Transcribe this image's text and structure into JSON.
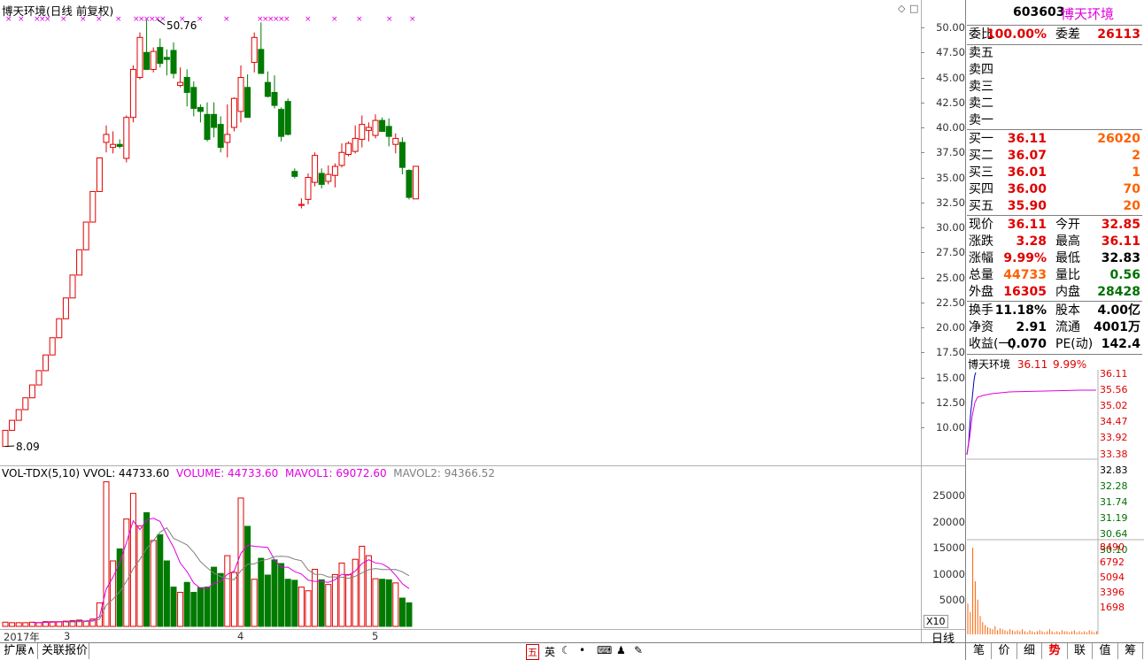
{
  "chart_header": {
    "title": "博天环境(日线 前复权)"
  },
  "annotations": {
    "high": "50.76",
    "low": "8.09"
  },
  "y_axis": {
    "ticks": [
      "50.00",
      "47.50",
      "45.00",
      "42.50",
      "40.00",
      "37.50",
      "35.00",
      "32.50",
      "30.00",
      "27.50",
      "25.00",
      "22.50",
      "20.00",
      "17.50",
      "15.00",
      "12.50",
      "10.00"
    ]
  },
  "volume_header": {
    "indicator": "VOL-TDX(5,10)",
    "vvol": "VVOL: 44733.60",
    "volume": "VOLUME: 44733.60",
    "mavol1": "MAVOL1: 69072.60",
    "mavol2": "MAVOL2: 94366.52"
  },
  "volume_axis": {
    "ticks": [
      "25000",
      "20000",
      "15000",
      "10000",
      "5000"
    ],
    "unit": "X10"
  },
  "x_axis": {
    "labels": [
      "2017年",
      "3",
      "4",
      "5"
    ]
  },
  "period_button": "日线",
  "bottom_tabs": {
    "expand": "扩展∧",
    "linked_quote": "关联报价"
  },
  "toolbar_icons": [
    "五",
    "英"
  ],
  "quote": {
    "code": "603603",
    "name": "博天环境",
    "weibi_label": "委比",
    "weibi_value": "100.00%",
    "weicha_label": "委差",
    "weicha_value": "26113",
    "sell": [
      {
        "label": "卖五"
      },
      {
        "label": "卖四"
      },
      {
        "label": "卖三"
      },
      {
        "label": "卖二"
      },
      {
        "label": "卖一"
      }
    ],
    "buy": [
      {
        "label": "买一",
        "price": "36.11",
        "vol": "26020"
      },
      {
        "label": "买二",
        "price": "36.07",
        "vol": "2"
      },
      {
        "label": "买三",
        "price": "36.01",
        "vol": "1"
      },
      {
        "label": "买四",
        "price": "36.00",
        "vol": "70"
      },
      {
        "label": "买五",
        "price": "35.90",
        "vol": "20"
      }
    ],
    "stats1": [
      {
        "l1": "现价",
        "v1": "36.11",
        "l2": "今开",
        "v2": "32.85"
      },
      {
        "l1": "涨跌",
        "v1": "3.28",
        "l2": "最高",
        "v2": "36.11"
      },
      {
        "l1": "涨幅",
        "v1": "9.99%",
        "l2": "最低",
        "v2": "32.83"
      },
      {
        "l1": "总量",
        "v1": "44733",
        "l2": "量比",
        "v2": "0.56"
      },
      {
        "l1": "外盘",
        "v1": "16305",
        "l2": "内盘",
        "v2": "28428"
      }
    ],
    "stats2": [
      {
        "l1": "换手",
        "v1": "11.18%",
        "l2": "股本",
        "v2": "4.00亿"
      },
      {
        "l1": "净资",
        "v1": "2.91",
        "l2": "流通",
        "v2": "4001万"
      },
      {
        "l1": "收益(一)",
        "v1": "0.070",
        "l2": "PE(动)",
        "v2": "142.4"
      }
    ]
  },
  "mini": {
    "name": "博天环境",
    "price": "36.11",
    "pct": "9.99%",
    "price_ticks": [
      "36.11",
      "35.56",
      "35.02",
      "34.47",
      "33.92",
      "33.38",
      "32.83",
      "32.28",
      "31.74",
      "31.19",
      "30.64",
      "30.10"
    ],
    "vol_ticks": [
      "8490",
      "6792",
      "5094",
      "3396",
      "1698"
    ]
  },
  "right_tabs": [
    "笔",
    "价",
    "细",
    "势",
    "联",
    "值",
    "筹"
  ],
  "colors": {
    "up": "#e00000",
    "down": "#007a00",
    "ma1": "#e000e0",
    "ma2": "#808080",
    "grid": "#b0b0b0"
  },
  "chart_data": {
    "type": "candlestick",
    "title": "博天环境(日线 前复权)",
    "ylim": [
      8.0,
      51.0
    ],
    "candles": [
      [
        8.09,
        9.7,
        8.09,
        9.7
      ],
      [
        9.7,
        10.7,
        9.7,
        10.7
      ],
      [
        10.7,
        11.77,
        10.7,
        11.77
      ],
      [
        11.77,
        12.95,
        11.77,
        12.95
      ],
      [
        12.95,
        14.24,
        12.95,
        14.24
      ],
      [
        14.24,
        15.67,
        14.24,
        15.67
      ],
      [
        15.67,
        17.24,
        15.67,
        17.24
      ],
      [
        17.24,
        18.96,
        17.24,
        18.96
      ],
      [
        18.96,
        20.86,
        18.96,
        20.86
      ],
      [
        20.86,
        22.94,
        20.86,
        22.94
      ],
      [
        22.94,
        25.23,
        22.94,
        25.23
      ],
      [
        25.23,
        27.76,
        25.23,
        27.76
      ],
      [
        27.76,
        30.53,
        27.76,
        30.53
      ],
      [
        30.53,
        33.59,
        30.53,
        33.59
      ],
      [
        33.59,
        36.95,
        33.59,
        36.95
      ],
      [
        38.5,
        40.2,
        37.5,
        39.3
      ],
      [
        38.0,
        39.6,
        37.4,
        38.3
      ],
      [
        38.3,
        38.8,
        37.9,
        38.1
      ],
      [
        36.9,
        41.2,
        36.5,
        41.0
      ],
      [
        41.0,
        46.2,
        40.5,
        45.8
      ],
      [
        45.0,
        49.5,
        44.8,
        49.0
      ],
      [
        47.5,
        50.76,
        46.8,
        45.8
      ],
      [
        45.8,
        48.0,
        45.5,
        47.6
      ],
      [
        48.0,
        48.9,
        46.0,
        46.4
      ],
      [
        47.0,
        47.8,
        45.2,
        46.8
      ],
      [
        47.7,
        48.5,
        44.9,
        45.4
      ],
      [
        44.2,
        46.0,
        44.0,
        44.5
      ],
      [
        45.0,
        45.8,
        42.1,
        43.5
      ],
      [
        44.0,
        44.6,
        41.1,
        41.9
      ],
      [
        42.0,
        42.3,
        40.5,
        41.6
      ],
      [
        41.3,
        42.5,
        38.6,
        38.8
      ],
      [
        41.3,
        42.5,
        39.0,
        40.0
      ],
      [
        40.3,
        41.1,
        37.5,
        38.0
      ],
      [
        38.5,
        42.3,
        37.0,
        39.3
      ],
      [
        40.0,
        43.0,
        39.6,
        42.9
      ],
      [
        41.6,
        46.2,
        40.5,
        45.0
      ],
      [
        44.0,
        45.3,
        41.0,
        41.0
      ],
      [
        46.5,
        49.5,
        45.5,
        49.0
      ],
      [
        47.8,
        50.5,
        46.8,
        45.4
      ],
      [
        44.5,
        45.6,
        43.0,
        43.1
      ],
      [
        43.5,
        45.2,
        41.9,
        42.2
      ],
      [
        41.8,
        42.0,
        38.6,
        39.1
      ],
      [
        42.6,
        42.9,
        39.2,
        39.3
      ],
      [
        35.6,
        35.9,
        34.9,
        35.1
      ],
      [
        32.2,
        32.9,
        31.9,
        32.3
      ],
      [
        32.8,
        35.4,
        32.3,
        35.0
      ],
      [
        34.5,
        37.5,
        34.1,
        37.2
      ],
      [
        35.4,
        35.9,
        33.9,
        34.3
      ],
      [
        34.6,
        36.2,
        34.3,
        35.3
      ],
      [
        35.2,
        36.4,
        34.0,
        36.1
      ],
      [
        36.2,
        38.4,
        36.0,
        37.5
      ],
      [
        37.3,
        38.6,
        37.1,
        38.4
      ],
      [
        37.6,
        40.2,
        37.4,
        38.9
      ],
      [
        38.8,
        41.2,
        38.0,
        40.3
      ],
      [
        39.7,
        40.5,
        38.6,
        40.0
      ],
      [
        39.2,
        41.3,
        38.9,
        40.7
      ],
      [
        40.7,
        41.0,
        39.6,
        39.6
      ],
      [
        40.1,
        40.9,
        38.1,
        39.1
      ],
      [
        38.3,
        39.4,
        37.4,
        38.9
      ],
      [
        38.5,
        39.0,
        35.3,
        36.0
      ],
      [
        35.7,
        35.8,
        32.8,
        33.0
      ],
      [
        32.85,
        36.11,
        32.83,
        36.11
      ]
    ],
    "volumes": [
      800,
      700,
      700,
      700,
      800,
      700,
      900,
      900,
      900,
      1000,
      1100,
      1200,
      1000,
      1400,
      4500,
      27600,
      12500,
      14800,
      20500,
      25400,
      19200,
      21700,
      16400,
      17500,
      12500,
      7500,
      6500,
      8400,
      6500,
      7400,
      7500,
      11300,
      10100,
      13500,
      10300,
      24500,
      19100,
      9000,
      13000,
      9800,
      12700,
      12000,
      9000,
      8800,
      7500,
      6800,
      10900,
      8900,
      8000,
      9900,
      12100,
      9900,
      12800,
      15300,
      13500,
      9100,
      9000,
      8900,
      8300,
      5400,
      4500
    ]
  }
}
